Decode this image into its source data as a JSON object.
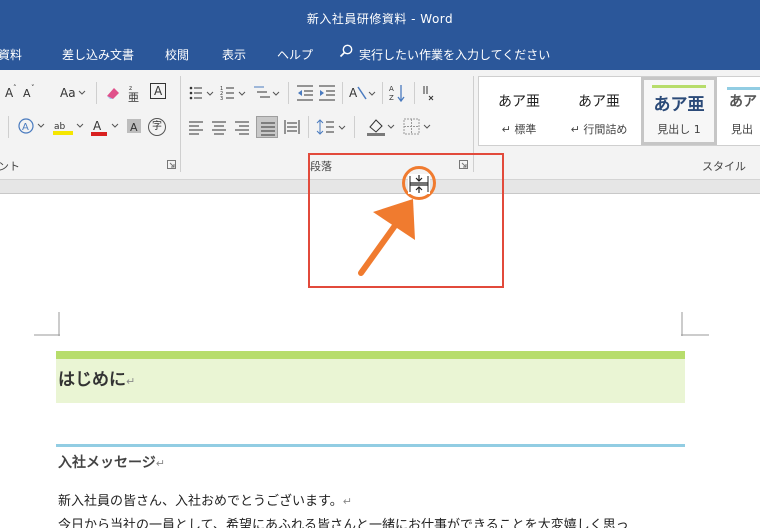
{
  "window": {
    "title": "新入社員研修資料 - Word"
  },
  "tabs": [
    {
      "label": "資料"
    },
    {
      "label": "差し込み文書"
    },
    {
      "label": "校閲"
    },
    {
      "label": "表示"
    },
    {
      "label": "ヘルプ"
    }
  ],
  "tell_me": {
    "label": "実行したい作業を入力してください",
    "icon": "search-icon"
  },
  "ribbon": {
    "font_group_label": "ント",
    "paragraph_group_label": "段落",
    "styles_group_label": "スタイル",
    "change_case_label": "Aa",
    "phonetic_label": "A",
    "enclose_label": "字",
    "sort_label": "A↓"
  },
  "styles": [
    {
      "sample": "あア亜",
      "name": "↵ 標準"
    },
    {
      "sample": "あア亜",
      "name": "↵ 行間詰め"
    },
    {
      "sample": "あア亜",
      "name": "見出し 1"
    },
    {
      "sample": "あア",
      "name": "見出"
    }
  ],
  "document": {
    "heading1": "はじめに",
    "heading2": "入社メッセージ",
    "para1": "新入社員の皆さん、入社おめでとうございます。",
    "para2": "今日から当社の一員として、希望にあふれる皆さんと一緒にお仕事ができることを大変嬉しく思っ"
  },
  "colors": {
    "titlebar": "#2b579a",
    "heading1_accent": "#b7dd6b",
    "heading1_fill": "#eaf5d4",
    "heading2_accent": "#92cde3",
    "highlight_box": "#e24a3b",
    "arrow": "#f07b2f"
  }
}
